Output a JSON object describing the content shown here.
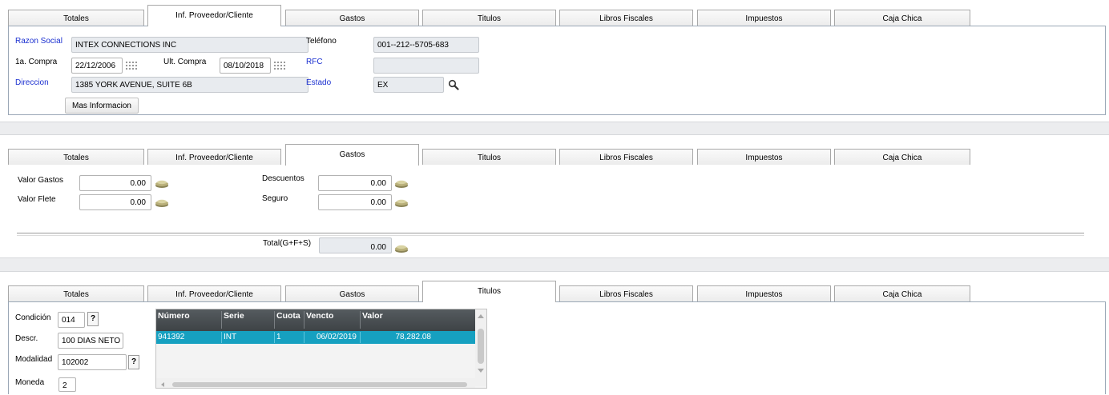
{
  "tabs": [
    "Totales",
    "Inf. Proveedor/Cliente",
    "Gastos",
    "Titulos",
    "Libros Fiscales",
    "Impuestos",
    "Caja Chica"
  ],
  "proveedor": {
    "razon_social_label": "Razon Social",
    "razon_social_value": "INTEX CONNECTIONS INC",
    "telefono_label": "Teléfono",
    "telefono_value": "001--212--5705-683",
    "primera_compra_label": "1a. Compra",
    "primera_compra_value": "22/12/2006",
    "ult_compra_label": "Ult. Compra",
    "ult_compra_value": "08/10/2018",
    "rfc_label": "RFC",
    "rfc_value": "",
    "direccion_label": "Direccion",
    "direccion_value": "1385 YORK AVENUE, SUITE 6B",
    "estado_label": "Estado",
    "estado_value": "EX",
    "mas_info_label": "Mas Informacion"
  },
  "gastos": {
    "valor_gastos_label": "Valor Gastos",
    "valor_gastos_value": "0.00",
    "valor_flete_label": "Valor Flete",
    "valor_flete_value": "0.00",
    "descuentos_label": "Descuentos",
    "descuentos_value": "0.00",
    "seguro_label": "Seguro",
    "seguro_value": "0.00",
    "total_label": "Total(G+F+S)",
    "total_value": "0.00"
  },
  "titulos": {
    "condicion_label": "Condición",
    "condicion_value": "014",
    "descr_label": "Descr.",
    "descr_value": "100 DIAS NETO",
    "modalidad_label": "Modalidad",
    "modalidad_value": "102002",
    "moneda_label": "Moneda",
    "moneda_value": "2",
    "lookup_label": "?",
    "grid_headers": [
      "Número",
      "Serie",
      "Cuota",
      "Vencto",
      "Valor"
    ],
    "grid_rows": [
      [
        "941392",
        "INT",
        "1",
        "06/02/2019",
        "78,282.08"
      ]
    ]
  },
  "colors": {
    "label_blue": "#1a2fd0",
    "grid_header": "#474c50",
    "grid_selected": "#16a0c0"
  }
}
